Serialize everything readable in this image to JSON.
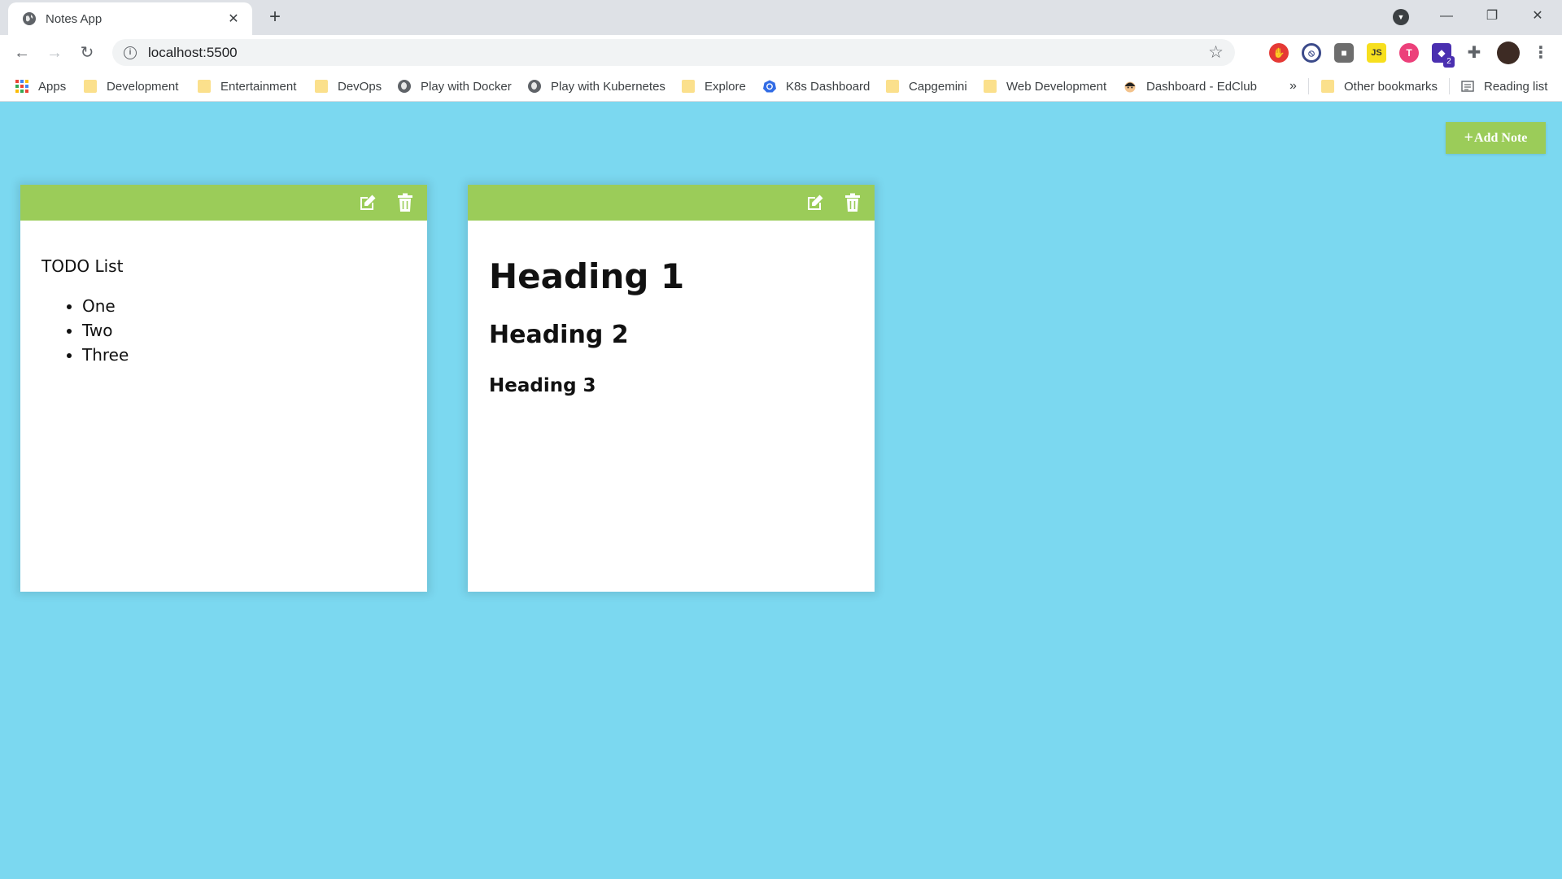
{
  "browser": {
    "tab_title": "Notes App",
    "new_tab_label": "+",
    "url": "localhost:5500",
    "window_controls": {
      "minimize": "—",
      "restore": "❐",
      "close": "✕"
    }
  },
  "bookmarks": {
    "items": [
      {
        "label": "Apps",
        "icon": "apps-grid-icon"
      },
      {
        "label": "Development",
        "icon": "folder-icon"
      },
      {
        "label": "Entertainment",
        "icon": "folder-icon"
      },
      {
        "label": "DevOps",
        "icon": "folder-icon"
      },
      {
        "label": "Play with Docker",
        "icon": "globe-icon"
      },
      {
        "label": "Play with Kubernetes",
        "icon": "globe-icon"
      },
      {
        "label": "Explore",
        "icon": "folder-icon"
      },
      {
        "label": "K8s Dashboard",
        "icon": "kubernetes-icon"
      },
      {
        "label": "Capgemini",
        "icon": "folder-icon"
      },
      {
        "label": "Web Development",
        "icon": "folder-icon"
      },
      {
        "label": "Dashboard - EdClub",
        "icon": "edclub-icon"
      }
    ],
    "overflow": "»",
    "other_bookmarks": "Other bookmarks",
    "reading_list": "Reading list"
  },
  "extensions": {
    "badge_count": "2",
    "js_label": "JS",
    "t_label": "T"
  },
  "page": {
    "add_note_label": "Add Note",
    "add_note_plus": "+",
    "accent_color": "#9bcc59",
    "background_color": "#7bd8f0"
  },
  "notes": [
    {
      "paragraph": "TODO List",
      "list": [
        "One",
        "Two",
        "Three"
      ]
    },
    {
      "h1": "Heading 1",
      "h2": "Heading 2",
      "h3": "Heading 3"
    }
  ]
}
